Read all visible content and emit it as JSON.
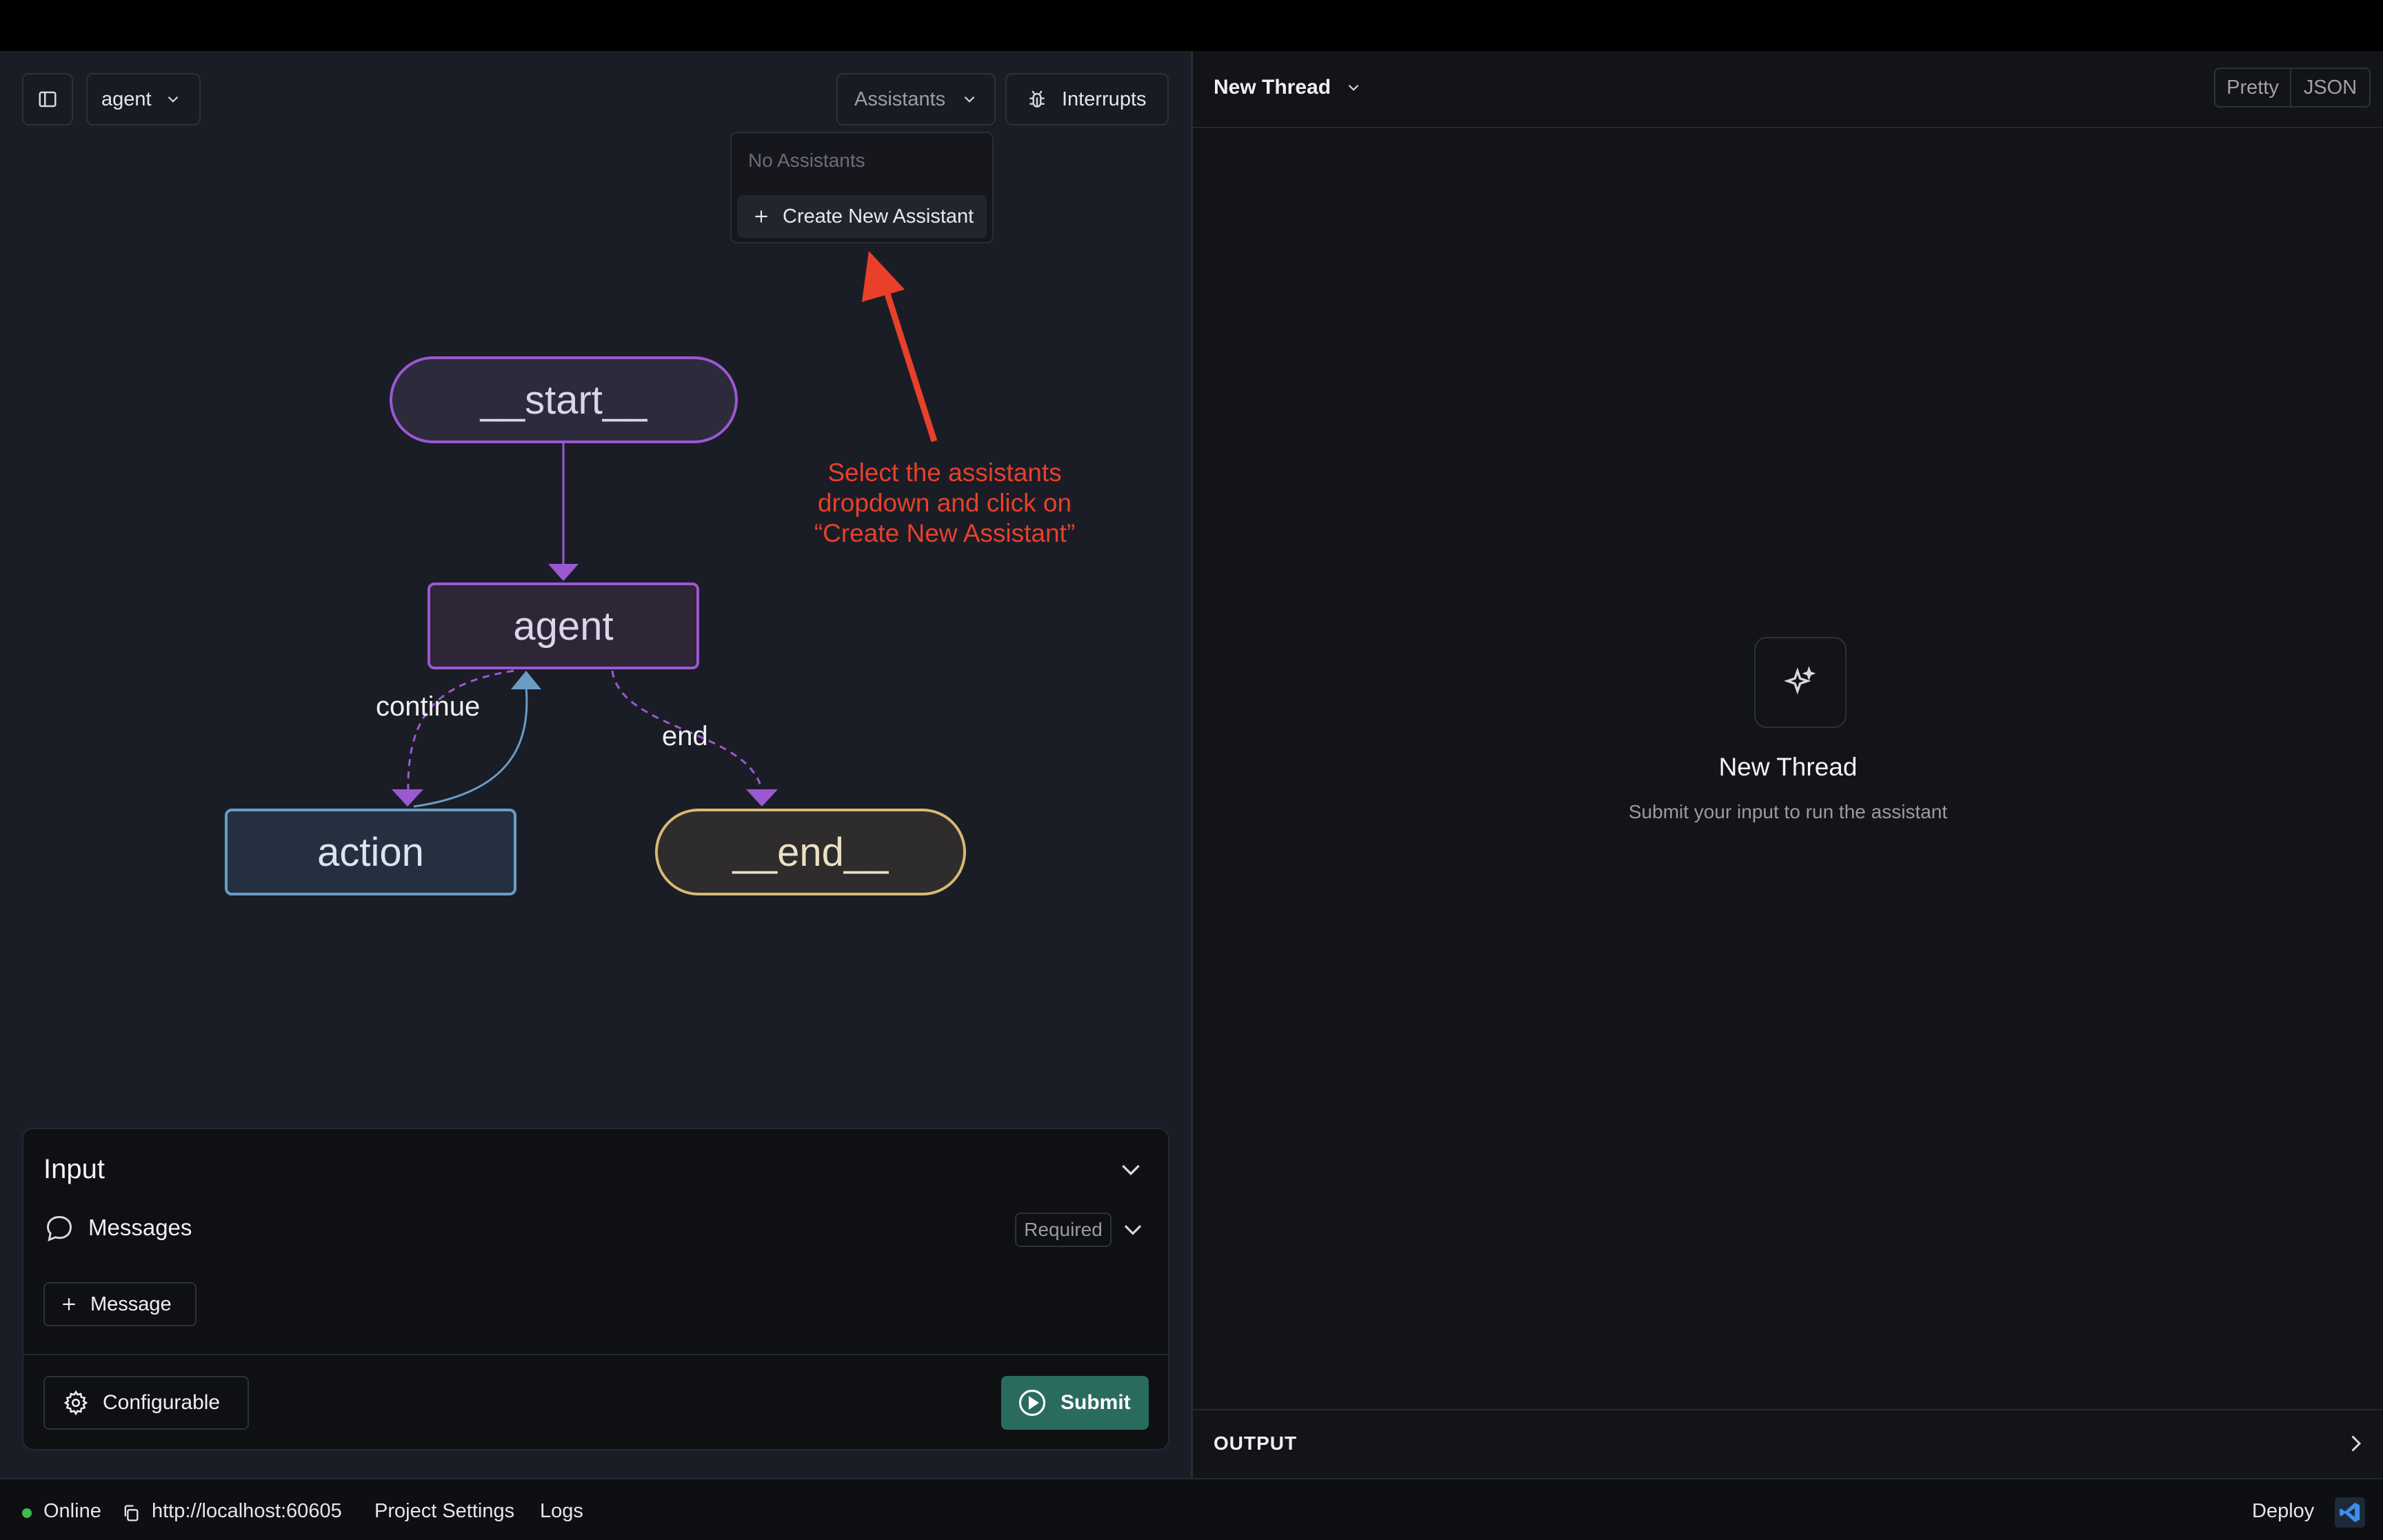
{
  "header": {
    "graph_select": "agent",
    "assistants_label": "Assistants",
    "interrupts_label": "Interrupts"
  },
  "assistants_dropdown": {
    "empty_text": "No Assistants",
    "create_label": "Create New Assistant"
  },
  "annotation": {
    "line1": "Select the assistants",
    "line2": "dropdown and click on",
    "line3": "“Create New Assistant”",
    "color": "#e8402a"
  },
  "graph": {
    "nodes": {
      "start": "__start__",
      "agent": "agent",
      "action": "action",
      "end": "__end__"
    },
    "edges": {
      "continue": "continue",
      "end": "end"
    }
  },
  "input_panel": {
    "title": "Input",
    "messages_label": "Messages",
    "required_badge": "Required",
    "add_message_label": "Message",
    "configurable_label": "Configurable",
    "submit_label": "Submit"
  },
  "thread": {
    "title": "New Thread",
    "view_pretty": "Pretty",
    "view_json": "JSON",
    "empty_title": "New Thread",
    "empty_subtitle": "Submit your input to run the assistant",
    "output_label": "OUTPUT"
  },
  "statusbar": {
    "status": "Online",
    "url": "http://localhost:60605",
    "project_settings": "Project Settings",
    "logs": "Logs",
    "deploy": "Deploy"
  },
  "colors": {
    "accent_purple": "#9c58d0",
    "action_blue": "#6b9cc6",
    "end_gold": "#d8b873",
    "submit_green": "#2a6b5f",
    "online_green": "#3fb950"
  }
}
